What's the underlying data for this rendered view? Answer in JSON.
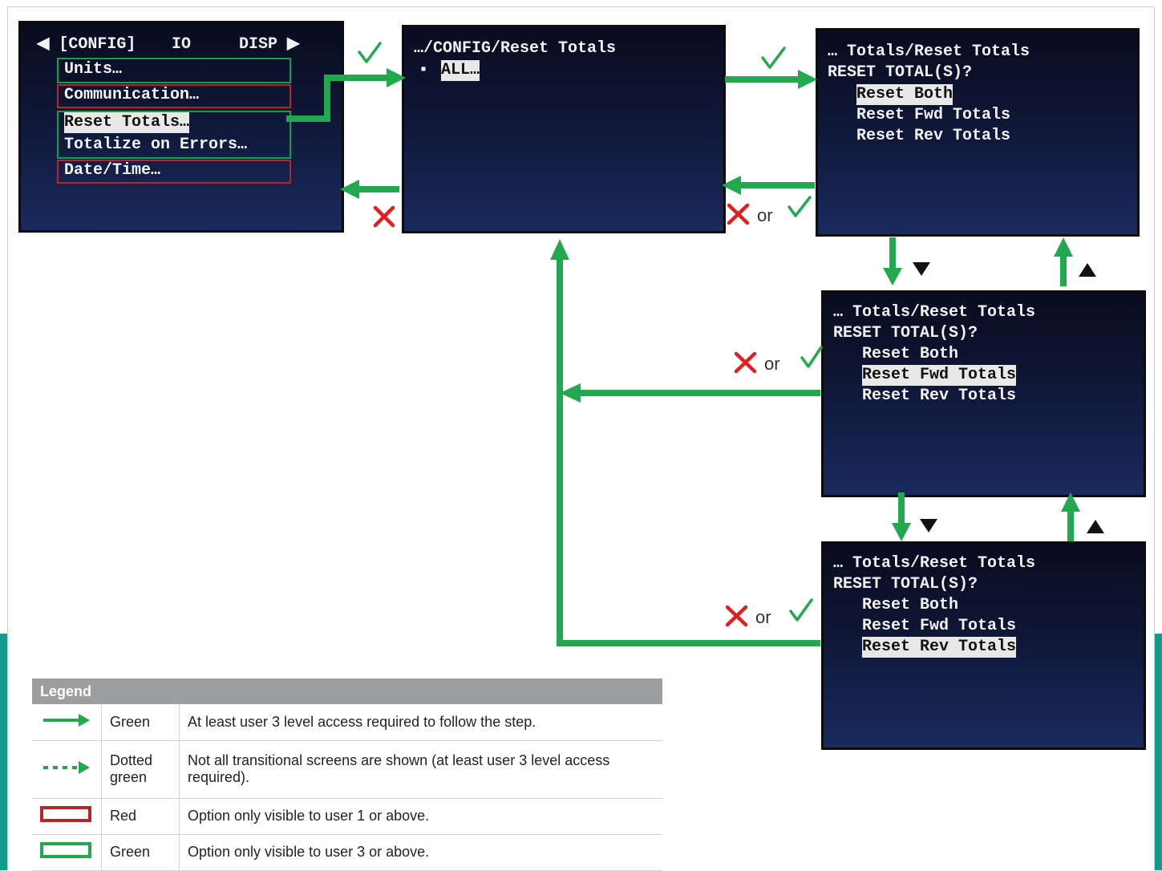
{
  "screen1": {
    "header_left": "◀ [CONFIG]",
    "header_io": "IO",
    "header_disp": "DISP ▶",
    "items": [
      "Units…",
      "Communication…",
      "Reset Totals…",
      "Totalize on Errors…",
      "Date/Time…"
    ]
  },
  "screen2": {
    "path": "…/CONFIG/Reset Totals",
    "bullet": "▪",
    "item": "ALL…"
  },
  "screen3": {
    "path": "… Totals/Reset Totals",
    "prompt": "RESET TOTAL(S)?",
    "items": [
      "Reset Both",
      "Reset Fwd Totals",
      "Reset Rev Totals"
    ]
  },
  "screen4": {
    "path": "… Totals/Reset Totals",
    "prompt": "RESET TOTAL(S)?",
    "items": [
      "Reset Both",
      "Reset Fwd Totals",
      "Reset Rev Totals"
    ]
  },
  "screen5": {
    "path": "… Totals/Reset Totals",
    "prompt": "RESET TOTAL(S)?",
    "items": [
      "Reset Both",
      "Reset Fwd Totals",
      "Reset Rev Totals"
    ]
  },
  "labels": {
    "or": "or"
  },
  "legend": {
    "title": "Legend",
    "rows": [
      {
        "symbol": "solid-green-arrow",
        "color_name": "Green",
        "description": "At least user 3 level access required to follow the step."
      },
      {
        "symbol": "dotted-green-arrow",
        "color_name": "Dotted green",
        "description": "Not all transitional screens are shown (at least user 3 level access required)."
      },
      {
        "symbol": "red-box",
        "color_name": "Red",
        "description": "Option only visible to user 1 or above."
      },
      {
        "symbol": "green-box",
        "color_name": "Green",
        "description": "Option only visible to user 3 or above."
      }
    ]
  },
  "colors": {
    "arrow_green": "#22a84f",
    "box_green": "#169c4a",
    "box_red": "#b3262a",
    "cross_red": "#e02020",
    "legend_header": "#9d9ea0",
    "accent_teal": "#129a8a"
  }
}
